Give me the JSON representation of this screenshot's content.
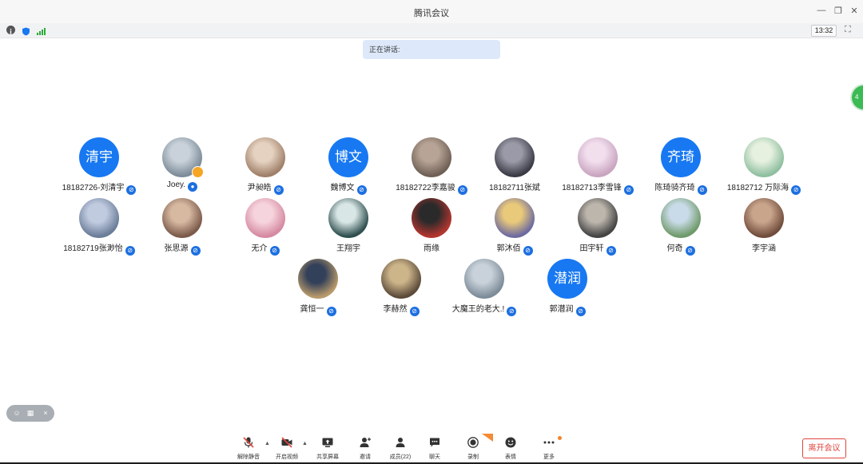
{
  "window": {
    "title": "腾讯会议"
  },
  "clock": "13:32",
  "speaking_label": "正在讲话:",
  "side_tab_text": "4",
  "colors": {
    "accent": "#1778f2",
    "leave": "#e0463d",
    "signal": "#2aaa3a"
  },
  "participants": [
    {
      "name": "18182726-刘清宇",
      "avatar_text": "清宇",
      "mic": "muted"
    },
    {
      "name": "Joey.",
      "avatar_text": "",
      "mic": "active",
      "host": true
    },
    {
      "name": "尹昶皓",
      "avatar_text": "",
      "mic": "muted"
    },
    {
      "name": "魏博文",
      "avatar_text": "博文",
      "mic": "muted"
    },
    {
      "name": "18182722李嘉骏",
      "avatar_text": "",
      "mic": "muted"
    },
    {
      "name": "18182711张斌",
      "avatar_text": "",
      "mic": "none"
    },
    {
      "name": "18182713李雪锋",
      "avatar_text": "",
      "mic": "muted"
    },
    {
      "name": "陈琦骑齐琦",
      "avatar_text": "齐琦",
      "mic": "muted"
    },
    {
      "name": "18182712 万际海",
      "avatar_text": "",
      "mic": "muted"
    },
    {
      "name": "18182719张渺怡",
      "avatar_text": "",
      "mic": "muted"
    },
    {
      "name": "张思源",
      "avatar_text": "",
      "mic": "muted"
    },
    {
      "name": "无介",
      "avatar_text": "",
      "mic": "muted"
    },
    {
      "name": "王翔宇",
      "avatar_text": "",
      "mic": "none"
    },
    {
      "name": "雨缘",
      "avatar_text": "",
      "mic": "none"
    },
    {
      "name": "郭沐佰",
      "avatar_text": "",
      "mic": "muted"
    },
    {
      "name": "田宇轩",
      "avatar_text": "",
      "mic": "muted"
    },
    {
      "name": "何奇",
      "avatar_text": "",
      "mic": "muted"
    },
    {
      "name": "李宇涵",
      "avatar_text": "",
      "mic": "none"
    },
    {
      "name": "龚恒一",
      "avatar_text": "",
      "mic": "muted"
    },
    {
      "name": "李赫然",
      "avatar_text": "",
      "mic": "muted"
    },
    {
      "name": "大魔王的老大.!",
      "avatar_text": "",
      "mic": "muted"
    },
    {
      "name": "郭潜润",
      "avatar_text": "潜润",
      "mic": "muted"
    }
  ],
  "toolbar": {
    "unmute": "解除静音",
    "video": "开启视频",
    "share": "共享屏幕",
    "invite": "邀请",
    "members": "成员(22)",
    "chat": "聊天",
    "record": "录制",
    "emoji": "表情",
    "more": "更多",
    "leave": "离开会议"
  },
  "icons": [
    "info-icon",
    "shield-icon",
    "signal-icon",
    "fullscreen-icon",
    "mic-muted-icon",
    "camera-off-icon",
    "share-screen-icon",
    "invite-icon",
    "members-icon",
    "chat-icon",
    "record-icon",
    "emoji-icon",
    "more-icon"
  ]
}
